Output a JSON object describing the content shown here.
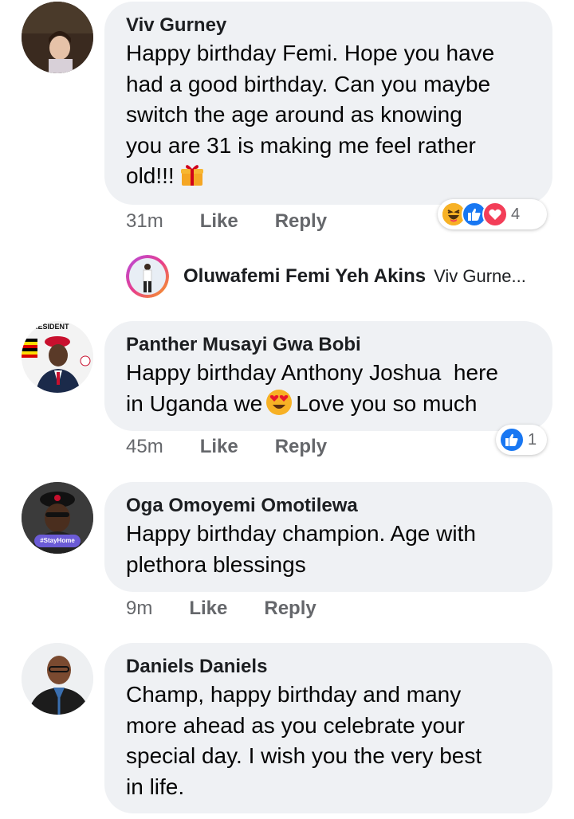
{
  "comments": [
    {
      "author": "Viv Gurney",
      "text": "Happy birthday Femi. Hope you have had a good birthday. Can you maybe switch the age around as knowing you are 31 is making me feel rather old!!!",
      "line1": "Happy birthday Femi. Hope you have",
      "line2": "had a good birthday. Can you maybe",
      "line3": "switch the age around as knowing",
      "line4": "you are 31 is making me feel rather",
      "line5": "old!!!",
      "time": "31m",
      "like_label": "Like",
      "reply_label": "Reply",
      "reaction_icons": [
        "haha-icon",
        "like-icon",
        "love-icon"
      ],
      "reaction_count": "4"
    },
    {
      "author": "Panther Musayi Gwa Bobi",
      "line1": "Happy birthday Anthony Joshua  here",
      "line2a": "in Uganda we",
      "line2b": "Love you so much",
      "time": "45m",
      "like_label": "Like",
      "reply_label": "Reply",
      "reaction_icons": [
        "like-icon"
      ],
      "reaction_count": "1",
      "avatar_text": "PRESIDENT"
    },
    {
      "author": "Oga Omoyemi Omotilewa",
      "line1": "Happy birthday champion. Age with",
      "line2": "plethora blessings",
      "time": "9m",
      "like_label": "Like",
      "reply_label": "Reply",
      "avatar_text": "#StayHome"
    },
    {
      "author": "Daniels Daniels",
      "line1": "Champ, happy birthday and many",
      "line2": "more ahead as you celebrate your",
      "line3": "special day. I wish you the very best",
      "line4": "in life."
    }
  ],
  "reply_preview": {
    "author": "Oluwafemi Femi Yeh Akins",
    "snippet": "Viv Gurne..."
  },
  "colors": {
    "bubble": "#eff1f4",
    "like_blue": "#1877f2",
    "love_red": "#f33e58",
    "meta_gray": "#65676b"
  }
}
